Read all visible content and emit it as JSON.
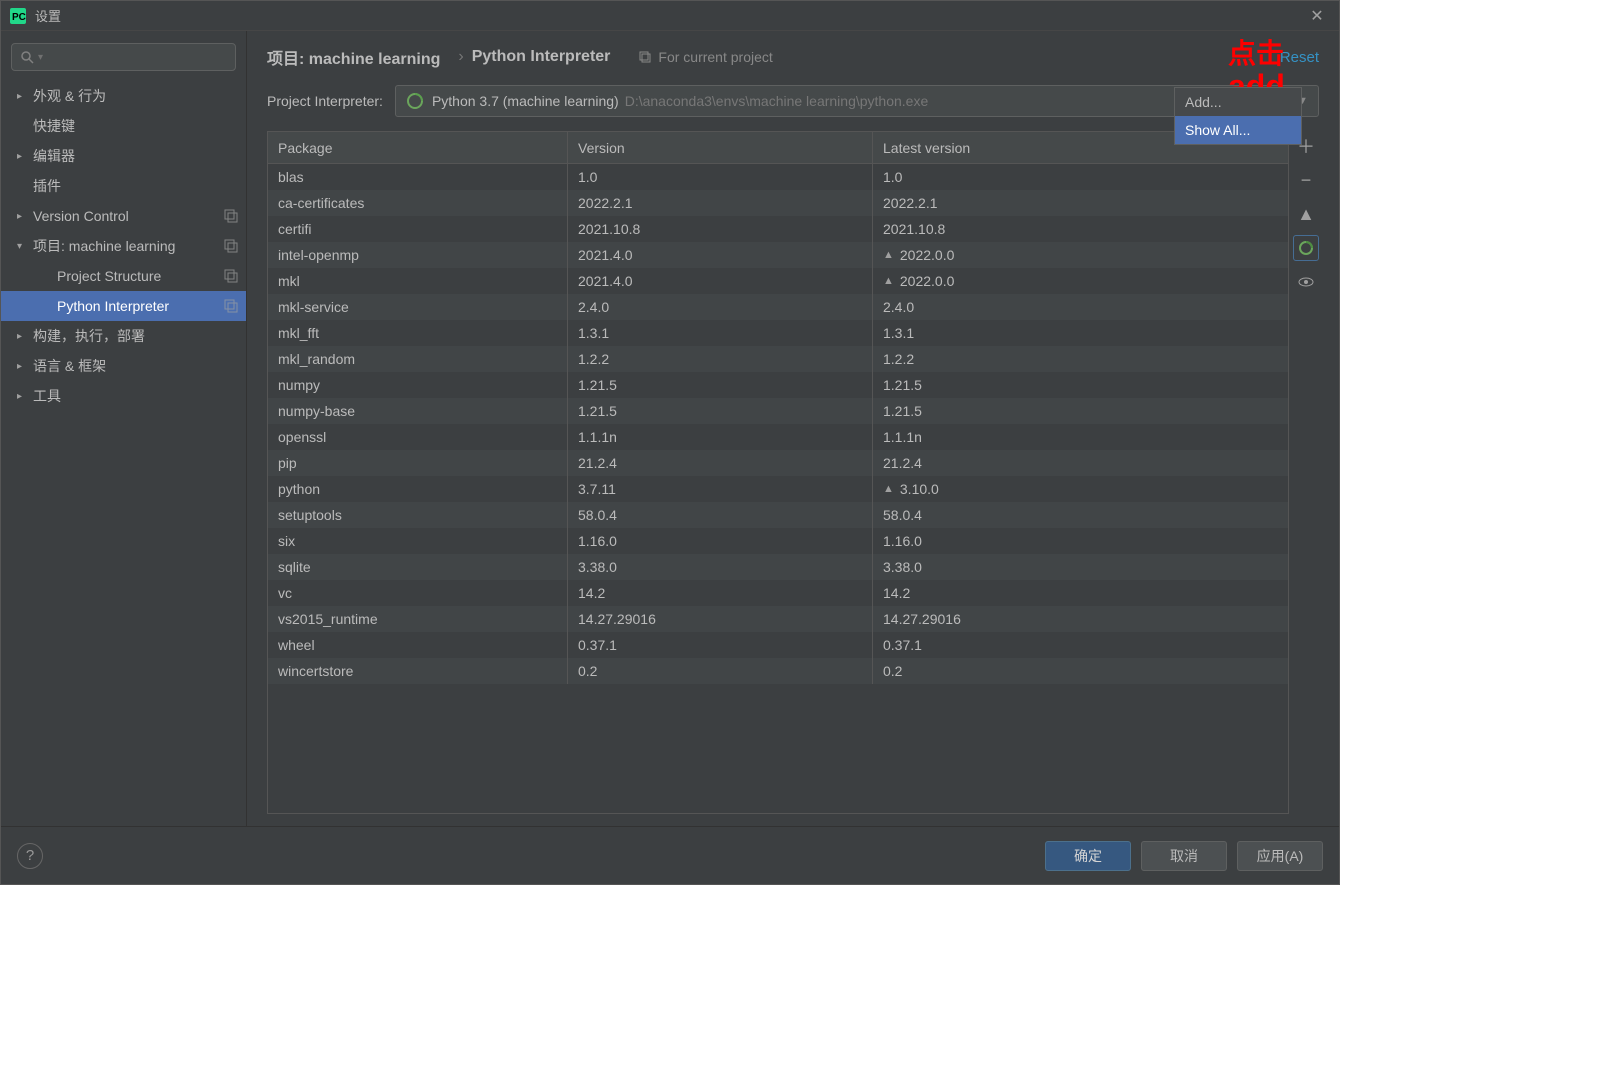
{
  "window": {
    "title": "设置"
  },
  "sidebar": {
    "items": [
      {
        "label": "外观 & 行为",
        "arrow": "collapsed",
        "level": 1,
        "badge": false
      },
      {
        "label": "快捷键",
        "arrow": "none",
        "level": 1,
        "badge": false
      },
      {
        "label": "编辑器",
        "arrow": "collapsed",
        "level": 1,
        "badge": false
      },
      {
        "label": "插件",
        "arrow": "none",
        "level": 1,
        "badge": false
      },
      {
        "label": "Version Control",
        "arrow": "collapsed",
        "level": 1,
        "badge": true
      },
      {
        "label": "项目: machine learning",
        "arrow": "expanded",
        "level": 1,
        "badge": true
      },
      {
        "label": "Project Structure",
        "arrow": "none",
        "level": 2,
        "badge": true
      },
      {
        "label": "Python Interpreter",
        "arrow": "none",
        "level": 2,
        "badge": true,
        "selected": true
      },
      {
        "label": "构建，执行，部署",
        "arrow": "collapsed",
        "level": 1,
        "badge": false
      },
      {
        "label": "语言 & 框架",
        "arrow": "collapsed",
        "level": 1,
        "badge": false
      },
      {
        "label": "工具",
        "arrow": "collapsed",
        "level": 1,
        "badge": false
      }
    ]
  },
  "breadcrumb": {
    "item1": "项目: machine learning",
    "item2": "Python Interpreter",
    "for_current": "For current project",
    "reset": "Reset"
  },
  "interpreter": {
    "label": "Project Interpreter:",
    "primary": "Python 3.7 (machine learning)",
    "secondary": "D:\\anaconda3\\envs\\machine learning\\python.exe"
  },
  "table": {
    "headers": {
      "pkg": "Package",
      "ver": "Version",
      "lat": "Latest version"
    },
    "rows": [
      {
        "pkg": "blas",
        "ver": "1.0",
        "lat": "1.0",
        "up": false
      },
      {
        "pkg": "ca-certificates",
        "ver": "2022.2.1",
        "lat": "2022.2.1",
        "up": false
      },
      {
        "pkg": "certifi",
        "ver": "2021.10.8",
        "lat": "2021.10.8",
        "up": false
      },
      {
        "pkg": "intel-openmp",
        "ver": "2021.4.0",
        "lat": "2022.0.0",
        "up": true
      },
      {
        "pkg": "mkl",
        "ver": "2021.4.0",
        "lat": "2022.0.0",
        "up": true
      },
      {
        "pkg": "mkl-service",
        "ver": "2.4.0",
        "lat": "2.4.0",
        "up": false
      },
      {
        "pkg": "mkl_fft",
        "ver": "1.3.1",
        "lat": "1.3.1",
        "up": false
      },
      {
        "pkg": "mkl_random",
        "ver": "1.2.2",
        "lat": "1.2.2",
        "up": false
      },
      {
        "pkg": "numpy",
        "ver": "1.21.5",
        "lat": "1.21.5",
        "up": false
      },
      {
        "pkg": "numpy-base",
        "ver": "1.21.5",
        "lat": "1.21.5",
        "up": false
      },
      {
        "pkg": "openssl",
        "ver": "1.1.1n",
        "lat": "1.1.1n",
        "up": false
      },
      {
        "pkg": "pip",
        "ver": "21.2.4",
        "lat": "21.2.4",
        "up": false
      },
      {
        "pkg": "python",
        "ver": "3.7.11",
        "lat": "3.10.0",
        "up": true
      },
      {
        "pkg": "setuptools",
        "ver": "58.0.4",
        "lat": "58.0.4",
        "up": false
      },
      {
        "pkg": "six",
        "ver": "1.16.0",
        "lat": "1.16.0",
        "up": false
      },
      {
        "pkg": "sqlite",
        "ver": "3.38.0",
        "lat": "3.38.0",
        "up": false
      },
      {
        "pkg": "vc",
        "ver": "14.2",
        "lat": "14.2",
        "up": false
      },
      {
        "pkg": "vs2015_runtime",
        "ver": "14.27.29016",
        "lat": "14.27.29016",
        "up": false
      },
      {
        "pkg": "wheel",
        "ver": "0.37.1",
        "lat": "0.37.1",
        "up": false
      },
      {
        "pkg": "wincertstore",
        "ver": "0.2",
        "lat": "0.2",
        "up": false
      }
    ]
  },
  "dropdown": {
    "add": "Add...",
    "showall": "Show All..."
  },
  "footer": {
    "ok": "确定",
    "cancel": "取消",
    "apply": "应用(A)"
  },
  "annotations": {
    "a1": "点击",
    "a2": "add"
  }
}
